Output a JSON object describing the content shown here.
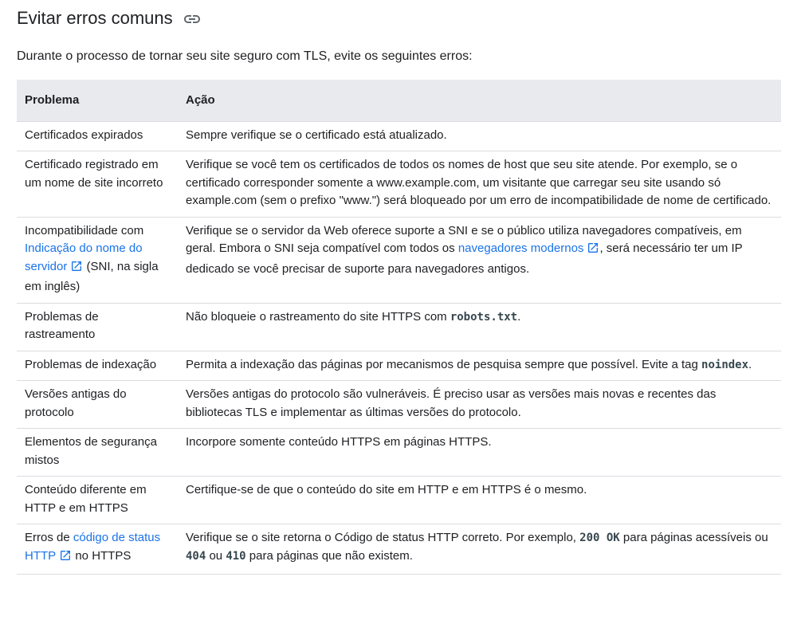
{
  "heading": "Evitar erros comuns",
  "intro": "Durante o processo de tornar seu site seguro com TLS, evite os seguintes erros:",
  "table": {
    "headers": [
      "Problema",
      "Ação"
    ],
    "rows": [
      {
        "problem": "Certificados expirados",
        "action": "Sempre verifique se o certificado está atualizado."
      },
      {
        "problem": "Certificado registrado em um nome de site incorreto",
        "action": "Verifique se você tem os certificados de todos os nomes de host que seu site atende. Por exemplo, se o certificado corresponder somente a www.example.com, um visitante que carregar seu site usando só example.com (sem o prefixo \"www.\") será bloqueado por um erro de incompatibilidade de nome de certificado."
      },
      {
        "problem_before": "Incompatibilidade com ",
        "problem_link": "Indicação do nome do servidor",
        "problem_after": " (SNI, na sigla em inglês)",
        "action_before": "Verifique se o servidor da Web oferece suporte a SNI e se o público utiliza navegadores compatíveis, em geral. Embora o SNI seja compatível com todos os ",
        "action_link": "navegadores modernos",
        "action_after": ", será necessário ter um IP dedicado se você precisar de suporte para navegadores antigos."
      },
      {
        "problem": "Problemas de rastreamento",
        "action_before": "Não bloqueie o rastreamento do site HTTPS com ",
        "action_code": "robots.txt",
        "action_after": "."
      },
      {
        "problem": "Problemas de indexação",
        "action_before": "Permita a indexação das páginas por mecanismos de pesquisa sempre que possível. Evite a tag ",
        "action_code": "noindex",
        "action_after": "."
      },
      {
        "problem": "Versões antigas do protocolo",
        "action": "Versões antigas do protocolo são vulneráveis. É preciso usar as versões mais novas e recentes das bibliotecas TLS e implementar as últimas versões do protocolo."
      },
      {
        "problem": "Elementos de segurança mistos",
        "action": "Incorpore somente conteúdo HTTPS em páginas HTTPS."
      },
      {
        "problem": "Conteúdo diferente em HTTP e em HTTPS",
        "action": "Certifique-se de que o conteúdo do site em HTTP e em HTTPS é o mesmo."
      },
      {
        "problem_before": "Erros de ",
        "problem_link": "código de status HTTP",
        "problem_after": " no HTTPS",
        "action_before": "Verifique se o site retorna o Código de status HTTP correto. Por exemplo, ",
        "action_code1": "200 OK",
        "action_mid1": " para páginas acessíveis ou ",
        "action_code2": "404",
        "action_mid2": " ou ",
        "action_code3": "410",
        "action_after": " para páginas que não existem."
      }
    ]
  },
  "icons": {
    "heading_link": "link-icon",
    "external": "open-in-new-icon"
  },
  "colors": {
    "link": "#1a73e8",
    "header_bg": "#e8eaed",
    "border": "#dadce0",
    "text": "#202124"
  }
}
